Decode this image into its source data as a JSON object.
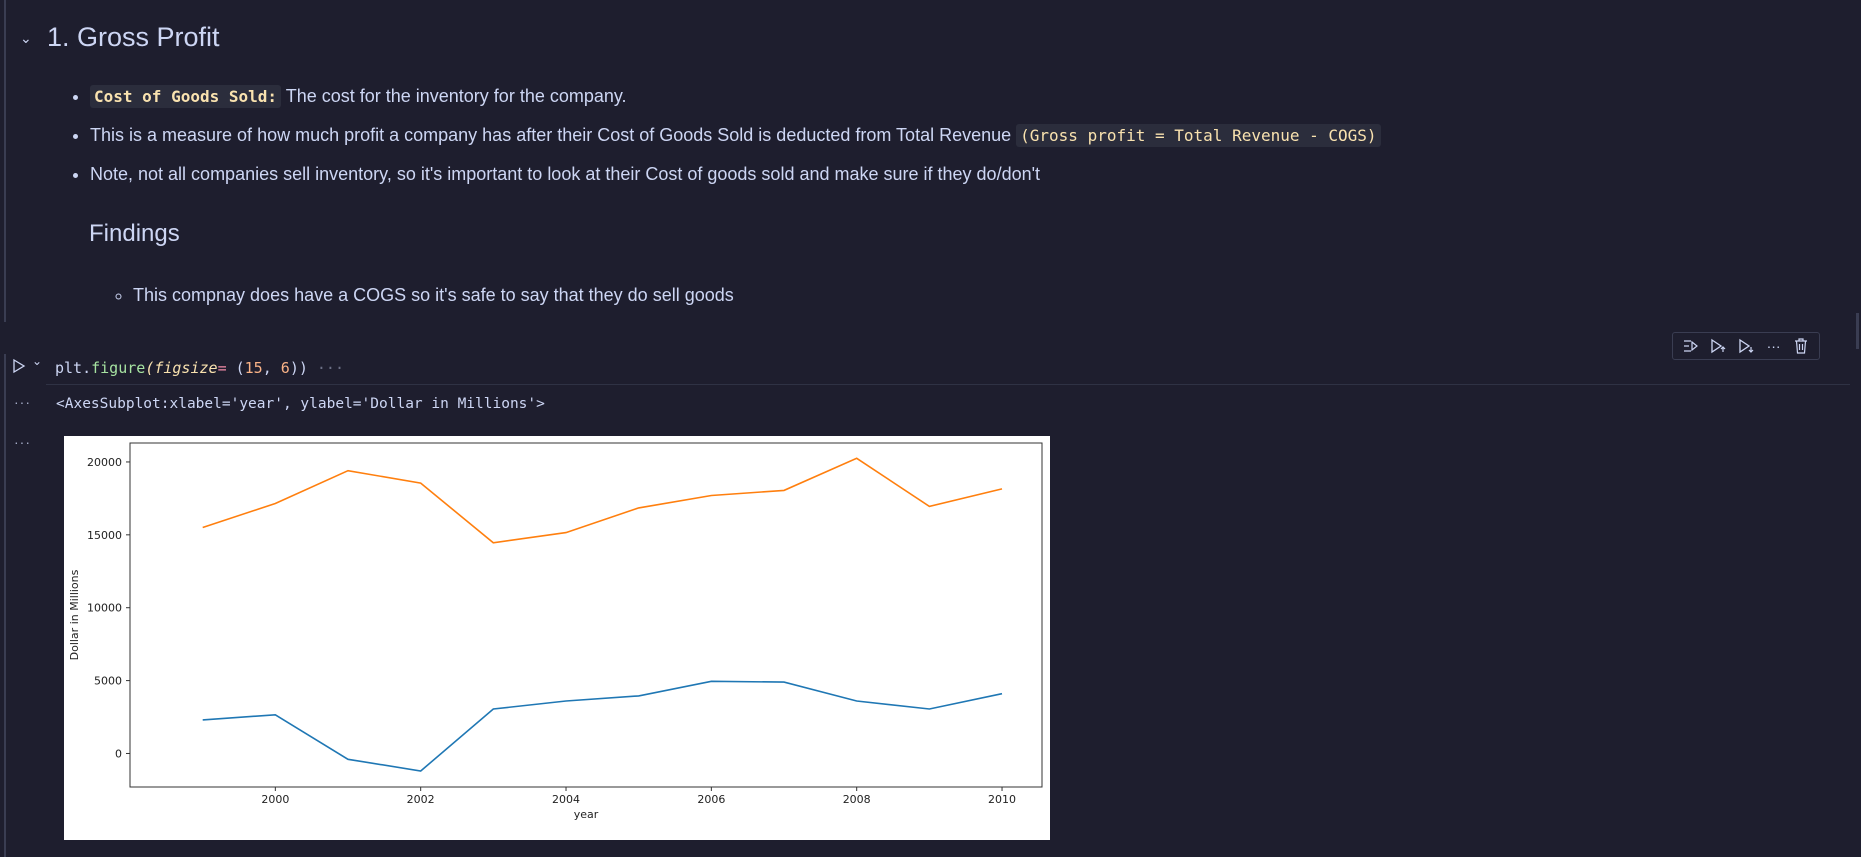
{
  "markdown": {
    "heading": "1. Gross Profit",
    "bullets": [
      {
        "code": "Cost of Goods Sold:",
        "text": " The cost for the inventory for the company."
      },
      {
        "text": "This is a measure of how much profit a company has after their Cost of Goods Sold is deducted from Total Revenue ",
        "code": "(Gross profit = Total Revenue - COGS)"
      },
      {
        "text": "Note, not all companies sell inventory, so it's important to look at their Cost of goods sold and make sure if they do/don't"
      }
    ],
    "findings_heading": "Findings",
    "findings_items": [
      "This compnay does have a COGS so it's safe to say that they do sell goods"
    ]
  },
  "code_cell": {
    "source": {
      "call": "plt.",
      "fn": "figure",
      "open": "(",
      "kw": "figsize",
      "eq": "=",
      "sp": " (",
      "n1": "15",
      "comma": ", ",
      "n2": "6",
      "close": "))",
      "ellipsis": "···"
    },
    "toolbar_icons": [
      "run-by-line-icon",
      "execute-above-icon",
      "execute-below-icon",
      "more-icon",
      "delete-icon"
    ],
    "output_text": "<AxesSubplot:xlabel='year', ylabel='Dollar in Millions'>",
    "output_dots": "···"
  },
  "chart_data": {
    "type": "line",
    "xlabel": "year",
    "ylabel": "Dollar in Millions",
    "x": [
      1999,
      2000,
      2001,
      2002,
      2003,
      2004,
      2005,
      2006,
      2007,
      2008,
      2009,
      2010
    ],
    "xticks": [
      2000,
      2002,
      2004,
      2006,
      2008,
      2010
    ],
    "yticks": [
      0,
      5000,
      10000,
      15000,
      20000
    ],
    "xlim": [
      1998.0,
      2010.55
    ],
    "ylim": [
      -2300,
      21300
    ],
    "grid": false,
    "series": [
      {
        "color": "#1f77b4",
        "values": [
          2300,
          2650,
          -400,
          -1200,
          3050,
          3600,
          3950,
          4950,
          4900,
          3600,
          3050,
          4100
        ]
      },
      {
        "color": "#ff7f0e",
        "values": [
          15500,
          17150,
          19400,
          18550,
          14450,
          15150,
          16850,
          17700,
          18050,
          20250,
          16950,
          18150
        ]
      }
    ]
  }
}
